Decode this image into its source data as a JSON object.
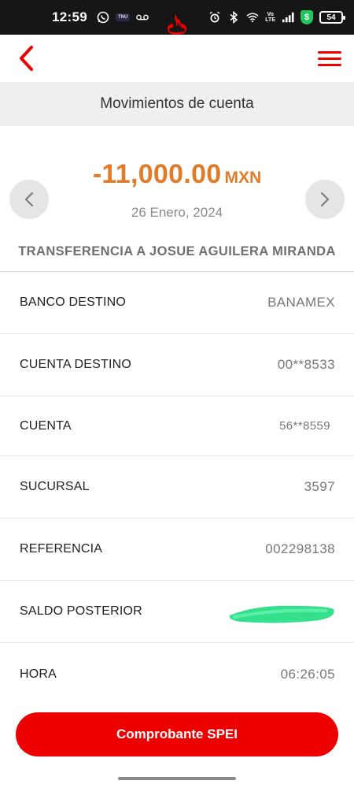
{
  "status_bar": {
    "time": "12:59",
    "carrier_chip": "TNU",
    "network": "LTE",
    "volte_top": "Vo",
    "volte_bottom": "LTE",
    "battery": "54"
  },
  "header": {
    "back_icon": "chevron-left-icon",
    "logo": "santander-flame-logo",
    "menu_icon": "hamburger-menu-icon",
    "accent": "#ec0000"
  },
  "subheader": {
    "title": "Movimientos de cuenta"
  },
  "movement": {
    "amount": "-11,000.00",
    "currency": "MXN",
    "date": "26 Enero, 2024",
    "description": "TRANSFERENCIA A JOSUE AGUILERA MIRANDA",
    "amount_color": "#e07b2a"
  },
  "details": [
    {
      "label": "BANCO DESTINO",
      "value": "BANAMEX"
    },
    {
      "label": "CUENTA DESTINO",
      "value": "00**8533"
    },
    {
      "label": "CUENTA",
      "value": "56**8559"
    },
    {
      "label": "SUCURSAL",
      "value": "3597"
    },
    {
      "label": "REFERENCIA",
      "value": "002298138"
    },
    {
      "label": "SALDO POSTERIOR",
      "value": ""
    },
    {
      "label": "HORA",
      "value": "06:26:05"
    }
  ],
  "cta": {
    "label": "Comprobante SPEI"
  }
}
